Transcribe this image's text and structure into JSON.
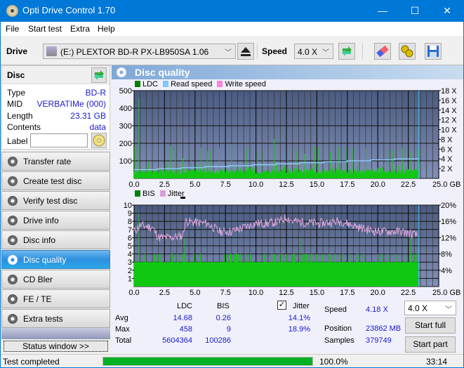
{
  "window": {
    "title": "Opti Drive Control 1.70",
    "minimize": "—",
    "maximize": "☐",
    "close": "✕"
  },
  "menu": [
    "File",
    "Start test",
    "Extra",
    "Help"
  ],
  "toolbar": {
    "drive_label": "Drive",
    "drive_value": "(E:)  PLEXTOR BD-R  PX-LB950SA 1.06",
    "speed_label": "Speed",
    "speed_value": "4.0 X",
    "icons": [
      "eject-icon",
      "refresh-icon",
      "erase-icon",
      "settings-icon",
      "save-icon"
    ]
  },
  "disc": {
    "header": "Disc",
    "fields": [
      {
        "label": "Type",
        "value": "BD-R"
      },
      {
        "label": "MID",
        "value": "VERBATIMe (000)"
      },
      {
        "label": "Length",
        "value": "23.31 GB"
      },
      {
        "label": "Contents",
        "value": "data"
      }
    ],
    "label_field_label": "Label",
    "label_value": ""
  },
  "nav": [
    {
      "label": "Transfer rate",
      "active": false
    },
    {
      "label": "Create test disc",
      "active": false
    },
    {
      "label": "Verify test disc",
      "active": false
    },
    {
      "label": "Drive info",
      "active": false
    },
    {
      "label": "Disc info",
      "active": false
    },
    {
      "label": "Disc quality",
      "active": true
    },
    {
      "label": "CD Bler",
      "active": false
    },
    {
      "label": "FE / TE",
      "active": false
    },
    {
      "label": "Extra tests",
      "active": false
    }
  ],
  "status_window_label": "Status window >>",
  "main": {
    "title": "Disc quality"
  },
  "chart_data": [
    {
      "type": "bar",
      "title": "LDC",
      "legend": [
        {
          "name": "LDC",
          "color": "#008000"
        },
        {
          "name": "Read speed",
          "color": "#80c8ff"
        },
        {
          "name": "Write speed",
          "color": "#ff80e0"
        }
      ],
      "xlabel": "GB",
      "xlim": [
        0,
        25
      ],
      "x_ticks": [
        "0.0",
        "2.5",
        "5.0",
        "7.5",
        "10.0",
        "12.5",
        "15.0",
        "17.5",
        "20.0",
        "22.5",
        "25.0 GB"
      ],
      "ylim": [
        0,
        500
      ],
      "y_ticks": [
        "500",
        "400",
        "300",
        "200",
        "100"
      ],
      "y2lim": [
        0,
        18
      ],
      "y2_ticks": [
        "18 X",
        "16 X",
        "14 X",
        "12 X",
        "10 X",
        "8 X",
        "6 X",
        "4 X",
        "2 X"
      ],
      "series": [
        {
          "name": "LDC",
          "baseline_avg": 40,
          "max": 458,
          "spikes": [
            [
              0.05,
              180
            ],
            [
              0.4,
              458
            ],
            [
              1.2,
              95
            ],
            [
              2.7,
              90
            ],
            [
              3.0,
              185
            ],
            [
              3.4,
              185
            ],
            [
              4.0,
              115
            ],
            [
              4.7,
              165
            ],
            [
              5.5,
              175
            ],
            [
              6.0,
              155
            ],
            [
              6.3,
              160
            ],
            [
              7.0,
              175
            ],
            [
              8.0,
              195
            ],
            [
              9.2,
              175
            ],
            [
              10.1,
              155
            ],
            [
              10.6,
              160
            ],
            [
              11.5,
              225
            ],
            [
              12.6,
              175
            ],
            [
              13.3,
              160
            ],
            [
              14.0,
              140
            ],
            [
              14.8,
              180
            ],
            [
              15.1,
              175
            ],
            [
              16.1,
              155
            ],
            [
              16.8,
              180
            ],
            [
              17.4,
              175
            ],
            [
              17.9,
              170
            ],
            [
              19.0,
              175
            ],
            [
              20.8,
              165
            ],
            [
              21.2,
              160
            ],
            [
              22.0,
              175
            ],
            [
              22.7,
              155
            ],
            [
              23.3,
              165
            ]
          ]
        },
        {
          "name": "Read speed",
          "unit": "X",
          "start": 1.8,
          "end": 4.2,
          "end_gb": 23.31
        }
      ]
    },
    {
      "type": "bar",
      "title": "BIS / Jitter",
      "legend": [
        {
          "name": "BIS",
          "color": "#008000"
        },
        {
          "name": "Jitter",
          "color": "#d8a0d8"
        }
      ],
      "xlabel": "GB",
      "xlim": [
        0,
        25
      ],
      "x_ticks": [
        "0.0",
        "2.5",
        "5.0",
        "7.5",
        "10.0",
        "12.5",
        "15.0",
        "17.5",
        "20.0",
        "22.5",
        "25.0 GB"
      ],
      "ylim": [
        0,
        10
      ],
      "y_ticks": [
        "10",
        "9",
        "8",
        "7",
        "6",
        "5",
        "4",
        "3",
        "2",
        "1"
      ],
      "y2lim": [
        0,
        20
      ],
      "y2_ticks": [
        "20%",
        "16%",
        "12%",
        "8%",
        "4%"
      ],
      "series": [
        {
          "name": "BIS",
          "baseline": 3,
          "max": 9,
          "spikes": [
            [
              0.4,
              9
            ],
            [
              4.1,
              6
            ],
            [
              13.6,
              6
            ],
            [
              22.7,
              6
            ]
          ]
        },
        {
          "name": "Jitter",
          "unit": "%",
          "points": [
            [
              0,
              13.5
            ],
            [
              0.5,
              15
            ],
            [
              1.5,
              14.5
            ],
            [
              2.0,
              12
            ],
            [
              3.0,
              12
            ],
            [
              4.0,
              12.5
            ],
            [
              4.2,
              16
            ],
            [
              6.0,
              15.5
            ],
            [
              7.0,
              13.5
            ],
            [
              8.0,
              13.5
            ],
            [
              9.0,
              14.5
            ],
            [
              10.0,
              15.5
            ],
            [
              11.0,
              15.5
            ],
            [
              12.0,
              16
            ],
            [
              12.5,
              17
            ],
            [
              13.0,
              16
            ],
            [
              15.0,
              15.5
            ],
            [
              17.0,
              16
            ],
            [
              18.0,
              15
            ],
            [
              19.0,
              14
            ],
            [
              20.0,
              13.5
            ],
            [
              21.0,
              13.5
            ],
            [
              22.0,
              13.5
            ],
            [
              23.3,
              12.5
            ]
          ]
        }
      ]
    }
  ],
  "stats": {
    "col_ldc": "LDC",
    "col_bis": "BIS",
    "jitter_label": "Jitter",
    "jitter_checked": true,
    "rows": [
      {
        "label": "Avg",
        "ldc": "14.68",
        "bis": "0.26",
        "jitter": "14.1%"
      },
      {
        "label": "Max",
        "ldc": "458",
        "bis": "9",
        "jitter": "18.9%"
      },
      {
        "label": "Total",
        "ldc": "5604364",
        "bis": "100286",
        "jitter": ""
      }
    ],
    "speed_label": "Speed",
    "speed_value": "4.18 X",
    "position_label": "Position",
    "position_value": "23862 MB",
    "samples_label": "Samples",
    "samples_value": "379749",
    "speed_select": "4.0 X",
    "start_full": "Start full",
    "start_part": "Start part"
  },
  "statusbar": {
    "text": "Test completed",
    "progress": 100.0,
    "progress_label": "100.0%",
    "time": "33:14"
  }
}
